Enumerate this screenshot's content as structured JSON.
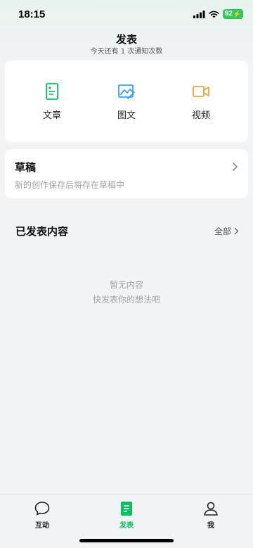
{
  "status_bar": {
    "time": "18:15",
    "battery": "92"
  },
  "header": {
    "title": "发表",
    "subtitle": "今天还有 1 次通知次数"
  },
  "create": [
    {
      "label": "文章",
      "icon": "article-icon",
      "color": "#07c160"
    },
    {
      "label": "图文",
      "icon": "image-text-icon",
      "color": "#3aa0e6"
    },
    {
      "label": "视频",
      "icon": "video-icon",
      "color": "#f0a23e"
    }
  ],
  "draft": {
    "title": "草稿",
    "description": "新的创作保存后将存在草稿中"
  },
  "published": {
    "title": "已发表内容",
    "all_label": "全部",
    "empty_line1": "暂无内容",
    "empty_line2": "快发表你的想法吧"
  },
  "tabs": [
    {
      "label": "互动",
      "icon": "chat-bubble-icon",
      "active": false
    },
    {
      "label": "发表",
      "icon": "document-icon",
      "active": true
    },
    {
      "label": "我",
      "icon": "person-icon",
      "active": false
    }
  ],
  "colors": {
    "accent": "#07c160",
    "background": "#f2f3f5"
  }
}
